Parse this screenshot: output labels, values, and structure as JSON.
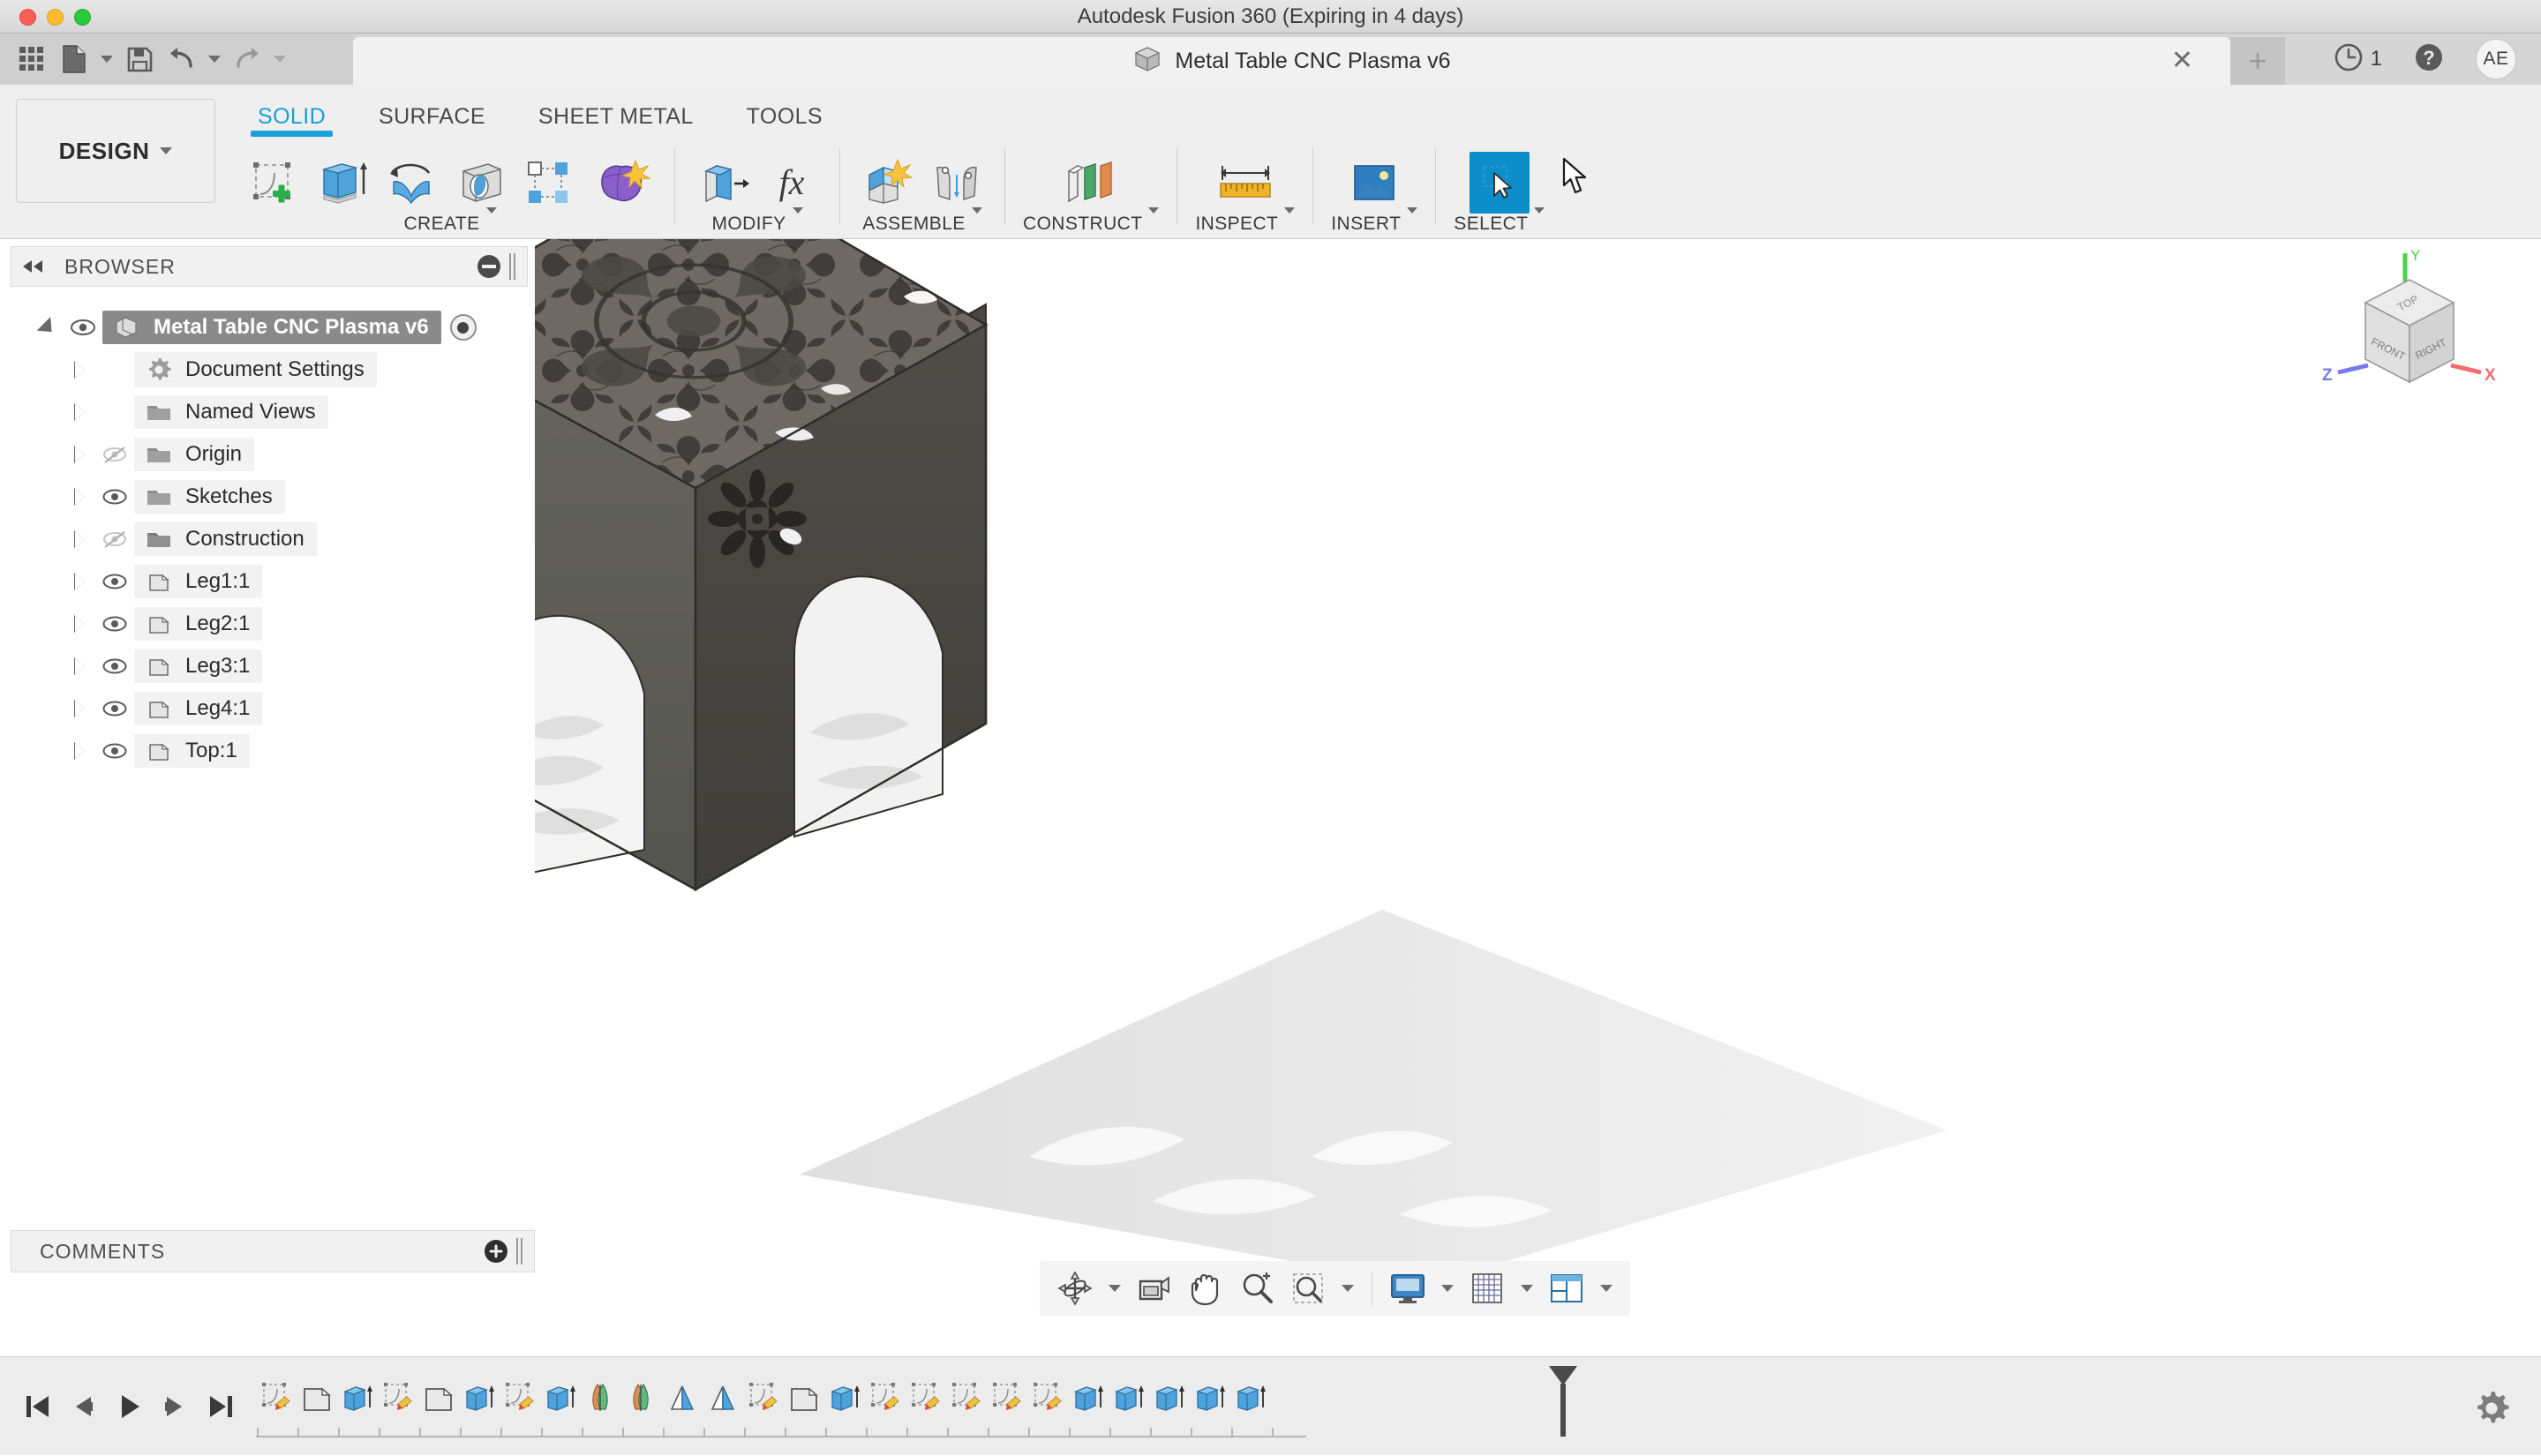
{
  "window": {
    "app_title": "Autodesk Fusion 360 (Expiring in 4 days)",
    "traffic_lights": [
      "close-red",
      "minimize-yellow",
      "zoom-green"
    ]
  },
  "quick_access": {
    "items": [
      {
        "name": "grid-menu-icon",
        "label": "Show Data Panel"
      },
      {
        "name": "file-icon",
        "label": "File"
      },
      {
        "name": "save-icon",
        "label": "Save"
      },
      {
        "name": "undo-icon",
        "label": "Undo"
      },
      {
        "name": "redo-icon",
        "label": "Redo"
      }
    ]
  },
  "document_tab": {
    "label": "Metal Table CNC Plasma v6",
    "icon": "document-cube-icon",
    "close_label": "✕"
  },
  "tab_bar": {
    "new_tab_label": "+",
    "job_status_icon": "clock-icon",
    "job_count": "1",
    "help_icon": "help-icon",
    "avatar_initials": "AE"
  },
  "workspace": {
    "label": "DESIGN"
  },
  "ribbon": {
    "tabs": [
      {
        "label": "SOLID",
        "active": true
      },
      {
        "label": "SURFACE",
        "active": false
      },
      {
        "label": "SHEET METAL",
        "active": false
      },
      {
        "label": "TOOLS",
        "active": false
      }
    ],
    "groups": [
      {
        "label": "CREATE",
        "has_caret": true,
        "icons": [
          "create-sketch-icon",
          "extrude-icon",
          "revolve-icon",
          "sweep-icon",
          "pattern-icon",
          "form-icon"
        ]
      },
      {
        "label": "MODIFY",
        "has_caret": true,
        "icons": [
          "press-pull-icon",
          "change-parameters-icon"
        ]
      },
      {
        "label": "ASSEMBLE",
        "has_caret": true,
        "icons": [
          "new-component-icon",
          "joint-icon"
        ]
      },
      {
        "label": "CONSTRUCT",
        "has_caret": true,
        "icons": [
          "offset-plane-icon"
        ]
      },
      {
        "label": "INSPECT",
        "has_caret": true,
        "icons": [
          "measure-icon"
        ]
      },
      {
        "label": "INSERT",
        "has_caret": true,
        "icons": [
          "insert-image-icon"
        ]
      },
      {
        "label": "SELECT",
        "has_caret": true,
        "icons": [
          "select-cursor-icon"
        ],
        "active": true
      }
    ]
  },
  "browser": {
    "title": "BROWSER",
    "collapse_icon": "collapse-left-icon",
    "minus_icon": "minus-circle-icon",
    "tree": [
      {
        "label": "Metal Table CNC Plasma v6",
        "icon": "component-icon",
        "visibility": "visible",
        "expander": "expanded",
        "selected": true,
        "has_radio": true,
        "indent": 0
      },
      {
        "label": "Document Settings",
        "icon": "gear-icon",
        "visibility": "none",
        "expander": "collapsed",
        "selected": false,
        "has_radio": false,
        "indent": 1
      },
      {
        "label": "Named Views",
        "icon": "folder-icon",
        "visibility": "none",
        "expander": "collapsed",
        "selected": false,
        "has_radio": false,
        "indent": 1
      },
      {
        "label": "Origin",
        "icon": "folder-icon",
        "visibility": "hidden",
        "expander": "collapsed",
        "selected": false,
        "has_radio": false,
        "indent": 1
      },
      {
        "label": "Sketches",
        "icon": "folder-icon",
        "visibility": "visible",
        "expander": "collapsed",
        "selected": false,
        "has_radio": false,
        "indent": 1
      },
      {
        "label": "Construction",
        "icon": "folder-icon",
        "visibility": "hidden",
        "expander": "collapsed",
        "selected": false,
        "has_radio": false,
        "indent": 1
      },
      {
        "label": "Leg1:1",
        "icon": "body-icon",
        "visibility": "visible",
        "expander": "collapsed",
        "selected": false,
        "has_radio": false,
        "indent": 1
      },
      {
        "label": "Leg2:1",
        "icon": "body-icon",
        "visibility": "visible",
        "expander": "collapsed",
        "selected": false,
        "has_radio": false,
        "indent": 1
      },
      {
        "label": "Leg3:1",
        "icon": "body-icon",
        "visibility": "visible",
        "expander": "collapsed",
        "selected": false,
        "has_radio": false,
        "indent": 1
      },
      {
        "label": "Leg4:1",
        "icon": "body-icon",
        "visibility": "visible",
        "expander": "collapsed",
        "selected": false,
        "has_radio": false,
        "indent": 1
      },
      {
        "label": "Top:1",
        "icon": "body-icon",
        "visibility": "visible",
        "expander": "collapsed",
        "selected": false,
        "has_radio": false,
        "indent": 1
      }
    ]
  },
  "comments": {
    "title": "COMMENTS",
    "add_icon": "plus-circle-icon"
  },
  "canvas": {
    "model_name": "Metal Table CNC Plasma",
    "model_description": "Decorative CNC plasma-cut metal side table, isometric view",
    "colors": {
      "top_plate": "#6e6a63",
      "leg_front": "#5c5c57",
      "leg_right": "#4a4743",
      "top_edge": "#57544e",
      "shadow": "#e4e4e4",
      "background": "#ffffff"
    },
    "viewcube": {
      "faces": [
        "TOP",
        "FRONT",
        "RIGHT"
      ],
      "axes": [
        {
          "label": "Y",
          "color": "#3dd13d"
        },
        {
          "label": "X",
          "color": "#f05a5a"
        },
        {
          "label": "Z",
          "color": "#6a6ae8"
        }
      ]
    }
  },
  "view_toolbar": {
    "items": [
      {
        "name": "orbit-icon",
        "caret": true
      },
      {
        "name": "look-at-icon",
        "caret": false
      },
      {
        "name": "pan-icon",
        "caret": false
      },
      {
        "name": "zoom-icon",
        "caret": false
      },
      {
        "name": "zoom-window-icon",
        "caret": true
      },
      {
        "name": "display-settings-icon",
        "caret": true
      },
      {
        "name": "grid-snaps-icon",
        "caret": true
      },
      {
        "name": "viewports-icon",
        "caret": true
      }
    ]
  },
  "timeline": {
    "controls": [
      {
        "name": "go-to-beginning-icon"
      },
      {
        "name": "step-back-icon"
      },
      {
        "name": "play-icon"
      },
      {
        "name": "step-forward-icon"
      },
      {
        "name": "go-to-end-icon"
      }
    ],
    "features": [
      "sketch-icon",
      "body-icon",
      "extrude-icon",
      "sketch-icon",
      "body-icon",
      "extrude-icon",
      "sketch-icon",
      "extrude-icon",
      "revolve-icon",
      "revolve-icon",
      "pattern-icon",
      "pattern-icon",
      "sketch-icon",
      "body-icon",
      "extrude-icon",
      "sketch-icon",
      "sketch-icon",
      "sketch-icon",
      "sketch-icon",
      "sketch-icon",
      "extrude-icon",
      "extrude-icon",
      "extrude-icon",
      "extrude-icon",
      "extrude-icon"
    ],
    "marker_position": "end",
    "settings_icon": "gear-icon"
  }
}
